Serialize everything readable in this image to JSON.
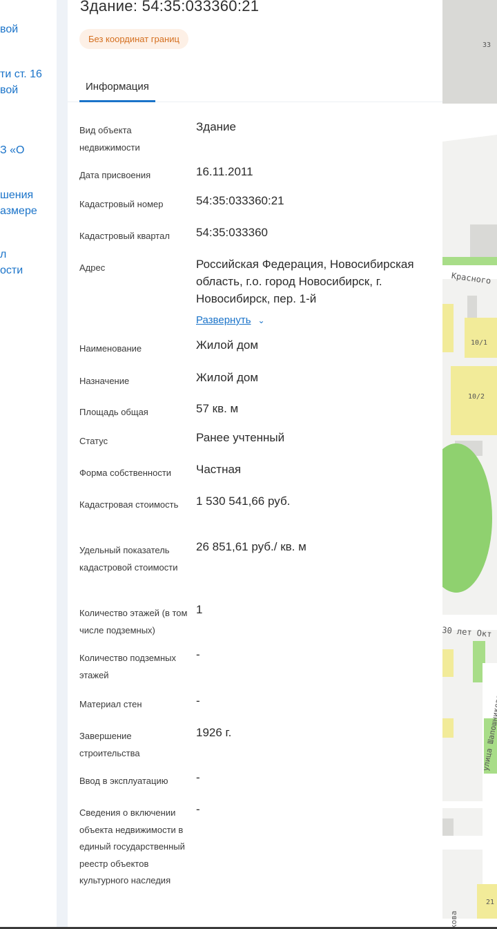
{
  "sidebar": {
    "links": [
      "вой",
      "ти ст. 16",
      "вой",
      "З «О",
      "шения",
      "азмере",
      "л",
      "ости"
    ]
  },
  "card": {
    "title": "Здание: 54:35:033360:21",
    "badge": "Без координат границ",
    "tab": "Информация",
    "expand_label": "Развернуть",
    "fields": [
      {
        "label": "Вид объекта недвижимости",
        "value": "Здание"
      },
      {
        "label": "Дата присвоения",
        "value": "16.11.2011"
      },
      {
        "label": "Кадастровый номер",
        "value": "54:35:033360:21"
      },
      {
        "label": "Кадастровый квартал",
        "value": "54:35:033360"
      },
      {
        "label": "Адрес",
        "value": "Российская Федерация, Новосибирская область, г.о. город Новосибирск, г. Новосибирск, пер. 1-й"
      },
      {
        "label": "Наименование",
        "value": "Жилой дом"
      },
      {
        "label": "Назначение",
        "value": "Жилой дом"
      },
      {
        "label": "Площадь общая",
        "value": "57 кв. м"
      },
      {
        "label": "Статус",
        "value": "Ранее учтенный"
      },
      {
        "label": "Форма собственности",
        "value": "Частная"
      },
      {
        "label": "Кадастровая стоимость",
        "value": "1 530 541,66 руб."
      },
      {
        "label": "Удельный показатель кадастровой стоимости",
        "value": "26 851,61 руб./ кв. м"
      },
      {
        "label": "Количество этажей (в том числе подземных)",
        "value": "1"
      },
      {
        "label": "Количество подземных этажей",
        "value": "-"
      },
      {
        "label": "Материал стен",
        "value": "-"
      },
      {
        "label": "Завершение строительства",
        "value": "1926 г."
      },
      {
        "label": "Ввод в эксплуатацию",
        "value": "-"
      },
      {
        "label": "Сведения о включении объекта недвижимости в единый государственный реестр объектов культурного наследия",
        "value": "-"
      }
    ]
  },
  "map": {
    "labels": [
      "33",
      "Красного",
      "10/1",
      "10/2",
      "30 лет Окт",
      "улица Шапошникова",
      "кова",
      "21"
    ],
    "colors": {
      "building": "#d9d9d6",
      "residential": "#f2eb99",
      "park": "#8fd16f"
    }
  },
  "colors": {
    "accent": "#1a73c9",
    "badge_bg": "#fdf0e6",
    "badge_text": "#d46f1f"
  }
}
